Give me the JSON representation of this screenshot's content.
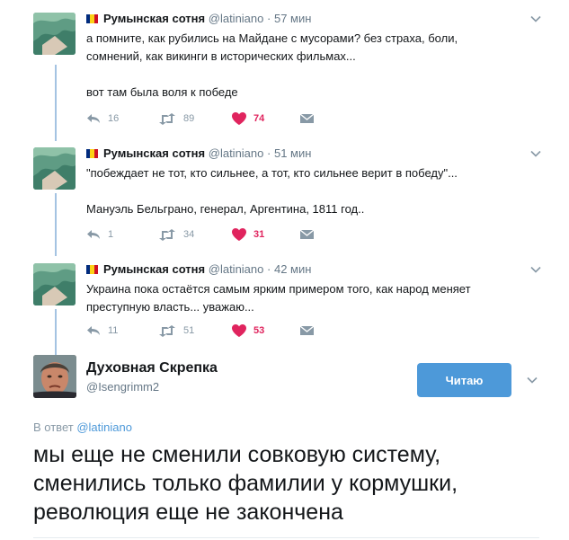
{
  "colors": {
    "thread_line": "#a4c3e2",
    "like_red": "#e0245e",
    "link_blue": "#4d99d9",
    "muted": "#657786"
  },
  "tweets": [
    {
      "name": "Румынская сотня",
      "handle": "@latiniano",
      "dot": "·",
      "time": "57 мин",
      "lines": [
        "а помните, как рубились на Майдане с мусорами? без страха, боли,",
        "сомнений, как викинги в исторических фильмах...",
        "",
        "вот там была воля к победе"
      ],
      "replies": "16",
      "retweets": "89",
      "likes": "74",
      "icons": [
        "flag-romania-icon",
        "chevron-down-icon",
        "reply-icon",
        "retweet-icon",
        "heart-icon",
        "message-icon"
      ]
    },
    {
      "name": "Румынская сотня",
      "handle": "@latiniano",
      "dot": "·",
      "time": "51 мин",
      "lines": [
        "\"побеждает не тот, кто сильнее, а тот, кто сильнее верит в победу\"...",
        "",
        "Мануэль Бельграно, генерал, Аргентина, 1811 год.."
      ],
      "replies": "1",
      "retweets": "34",
      "likes": "31"
    },
    {
      "name": "Румынская сотня",
      "handle": "@latiniano",
      "dot": "·",
      "time": "42 мин",
      "lines": [
        "Украина пока остаётся самым ярким примером того, как народ меняет",
        "преступную власть... уважаю..."
      ],
      "replies": "11",
      "retweets": "51",
      "likes": "53"
    }
  ],
  "main": {
    "name": "Духовная Скрепка",
    "handle": "@Isengrimm2",
    "follow_label": "Читаю",
    "reply_prefix": "В ответ",
    "reply_handle": "@latiniano",
    "text_lines": [
      "мы еще не сменили  совковую систему,",
      "сменились только фамилии у кормушки,",
      "революция еще не закончена"
    ]
  }
}
